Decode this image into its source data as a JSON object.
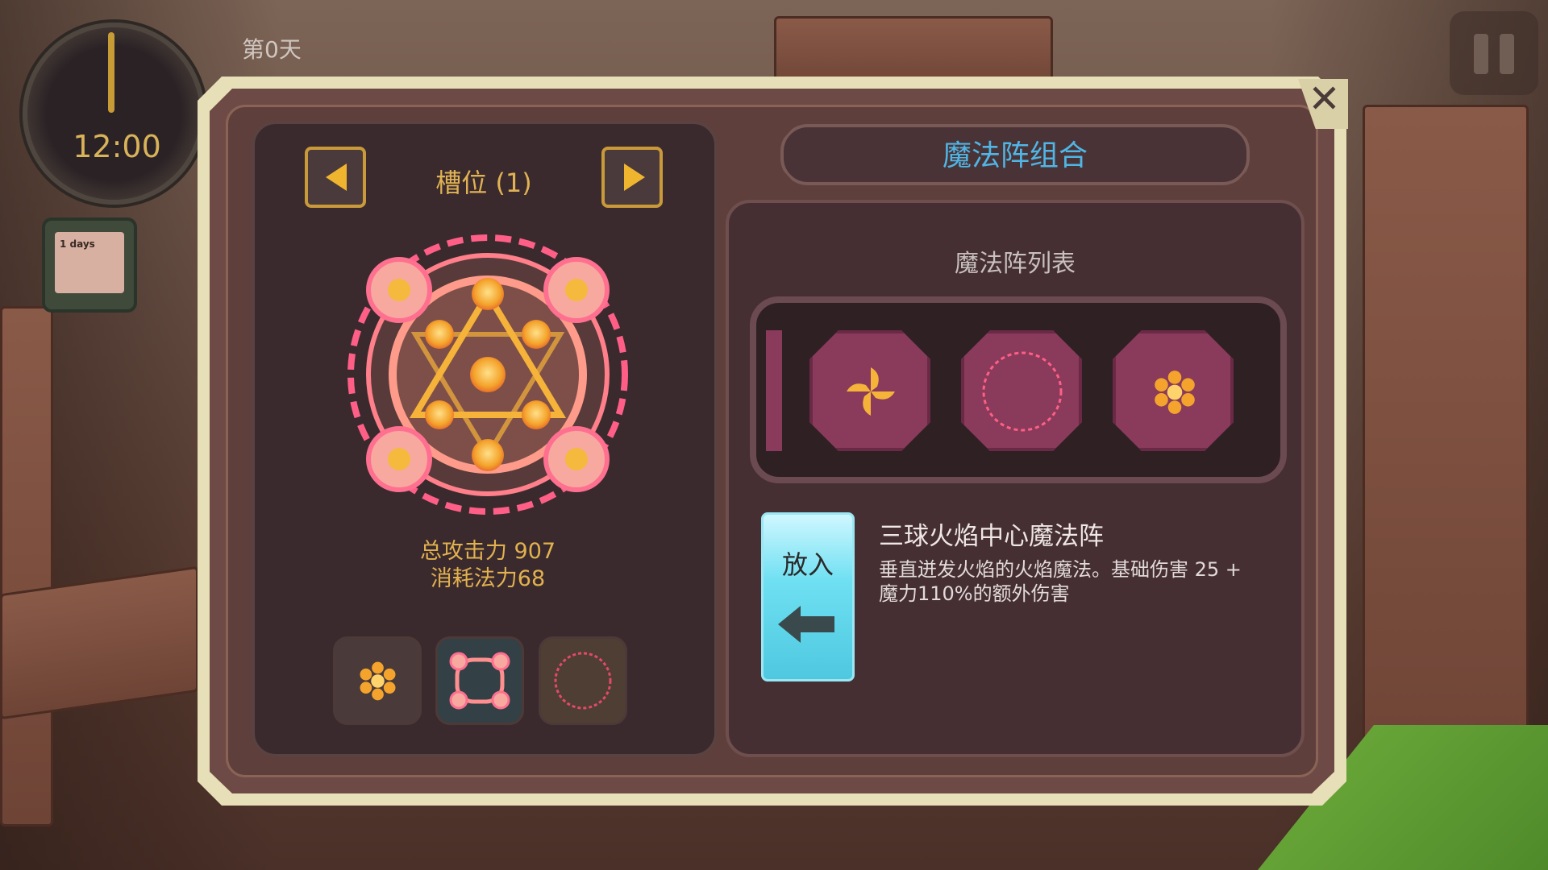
{
  "hud": {
    "day_label": "第0天",
    "clock_time": "12:00",
    "journal_label": "1 days"
  },
  "dialog": {
    "title": "魔法阵组合",
    "close_label": "✕"
  },
  "slot_panel": {
    "title": "槽位 (1)",
    "total_attack_label": "总攻击力 907",
    "mana_cost_label": "消耗法力68",
    "slots": [
      {
        "icon": "flower-rune-icon"
      },
      {
        "icon": "ring-of-orbs-icon"
      },
      {
        "icon": "empty-circle-icon"
      }
    ]
  },
  "magic_list": {
    "title": "魔法阵列表",
    "items": [
      {
        "icon": "pinwheel-rune-icon"
      },
      {
        "icon": "empty-circle-icon"
      },
      {
        "icon": "flower-rune-icon"
      }
    ]
  },
  "detail": {
    "place_button_label": "放入",
    "name": "三球火焰中心魔法阵",
    "description": "垂直迸发火焰的火焰魔法。基础伤害 25 + 魔力110%的额外伤害"
  },
  "colors": {
    "accent_gold": "#e2b14f",
    "title_blue": "#4fb6e6",
    "rune_pink": "#ff6f8f",
    "button_cyan": "#6fe0f2"
  }
}
